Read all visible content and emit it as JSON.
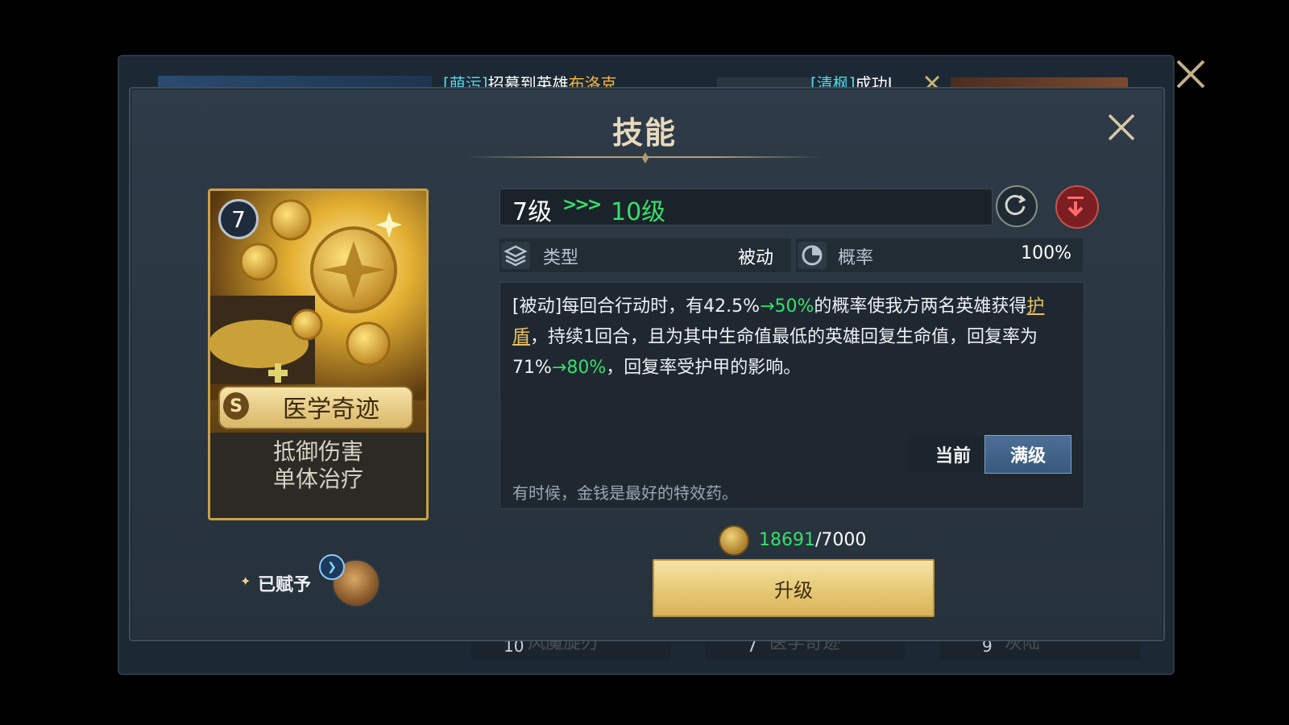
{
  "ticker": {
    "msg1_tag": "[萌污]",
    "msg1_text": "招募到英雄",
    "msg1_hero": "布洛克",
    "msg2_tag": "[清枫]",
    "msg2_text": "成功Ⅰ"
  },
  "background_tabs": [
    {
      "num": "10",
      "label": "风魔旋刃"
    },
    {
      "num": "7",
      "label": "医学奇迹"
    },
    {
      "num": "9",
      "label": "灰陆"
    }
  ],
  "dialog": {
    "title": "技能"
  },
  "card": {
    "level": "7",
    "rarity": "S",
    "name": "医学奇迹",
    "tag1": "抵御伤害",
    "tag2": "单体治疗"
  },
  "assigned": {
    "label": "已赋予",
    "hero_badge_icon": "wing-icon"
  },
  "level": {
    "current": "7级",
    "arrows": ">>>",
    "max": "10级"
  },
  "info": {
    "type_label": "类型",
    "type_value": "被动",
    "rate_label": "概率",
    "rate_value": "100%"
  },
  "description": {
    "p1": "[被动]每回合行动时，有42.5%",
    "p1_arrow": "→50%",
    "p2": "的概率使我方两名英雄获得",
    "link": "护盾",
    "p3": "，持续1回合，且为其中生命值最低的英雄回复生命值，回复率为71%",
    "p3_arrow": "→80%",
    "p4": "，回复率受护甲的影响。"
  },
  "toggle": {
    "current": "当前",
    "max": "满级"
  },
  "flavor": "有时候，金钱是最好的特效药。",
  "cost": {
    "owned": "18691",
    "sep": "/",
    "required": "7000"
  },
  "upgrade_label": "升级",
  "colors": {
    "accent_green": "#35e06a",
    "gold": "#e9c25f",
    "cyan": "#51d7e8"
  }
}
